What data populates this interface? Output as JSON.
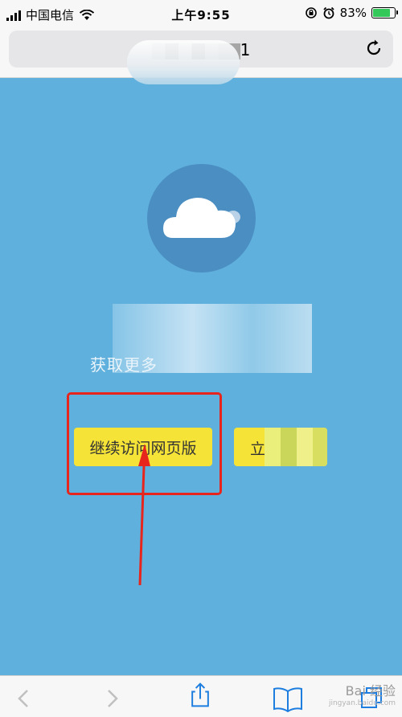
{
  "status_bar": {
    "carrier": "中国电信",
    "time": "上午9:55",
    "battery_percent": "83%",
    "battery_level": 0.83
  },
  "url_bar": {
    "url_suffix": "1"
  },
  "main": {
    "promo_text": "获取更多",
    "continue_button": "继续访问网页版",
    "app_button_prefix": "立"
  },
  "watermark": {
    "brand": "Bai 经验",
    "domain": "jingyan.baidu.com"
  },
  "colors": {
    "background": "#5fb0dc",
    "button": "#f5e337",
    "highlight": "#e8251d"
  }
}
